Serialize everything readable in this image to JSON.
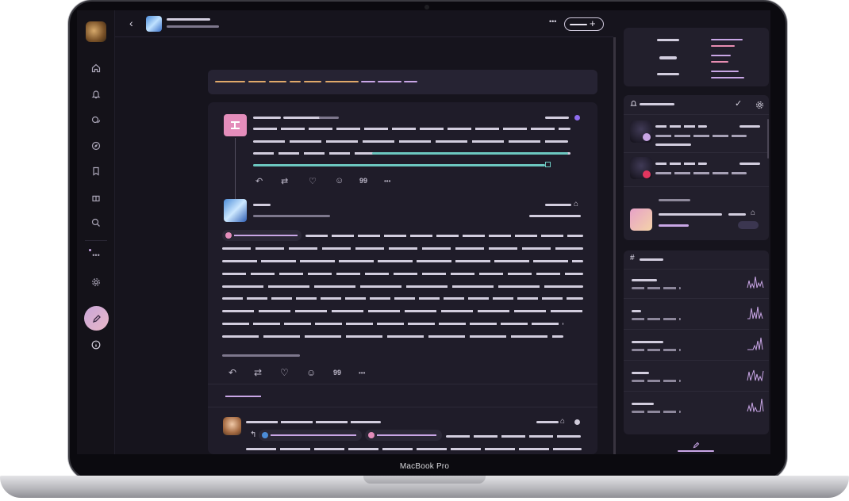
{
  "device": {
    "label": "MacBook Pro"
  },
  "rail": {
    "items": [
      "home-icon",
      "bell-icon",
      "chat-icon",
      "compass-icon",
      "bookmark-icon",
      "gift-icon",
      "search-icon",
      "more-icon",
      "gear-icon",
      "compose-icon",
      "info-icon"
    ]
  },
  "header": {
    "back": "‹",
    "more": "•••",
    "add": "+"
  },
  "actions": {
    "reply": "↶",
    "repost": "⇄",
    "like": "♡",
    "react": "☺",
    "quote": "99",
    "more": "•••"
  },
  "trending": {
    "hash": "#"
  },
  "colors": {
    "bg": "#16141d",
    "card": "#1f1c29",
    "accent": "#c9a6e6",
    "orange": "#e0a96a",
    "teal": "#6cc7c0",
    "pink": "#e88db2"
  }
}
